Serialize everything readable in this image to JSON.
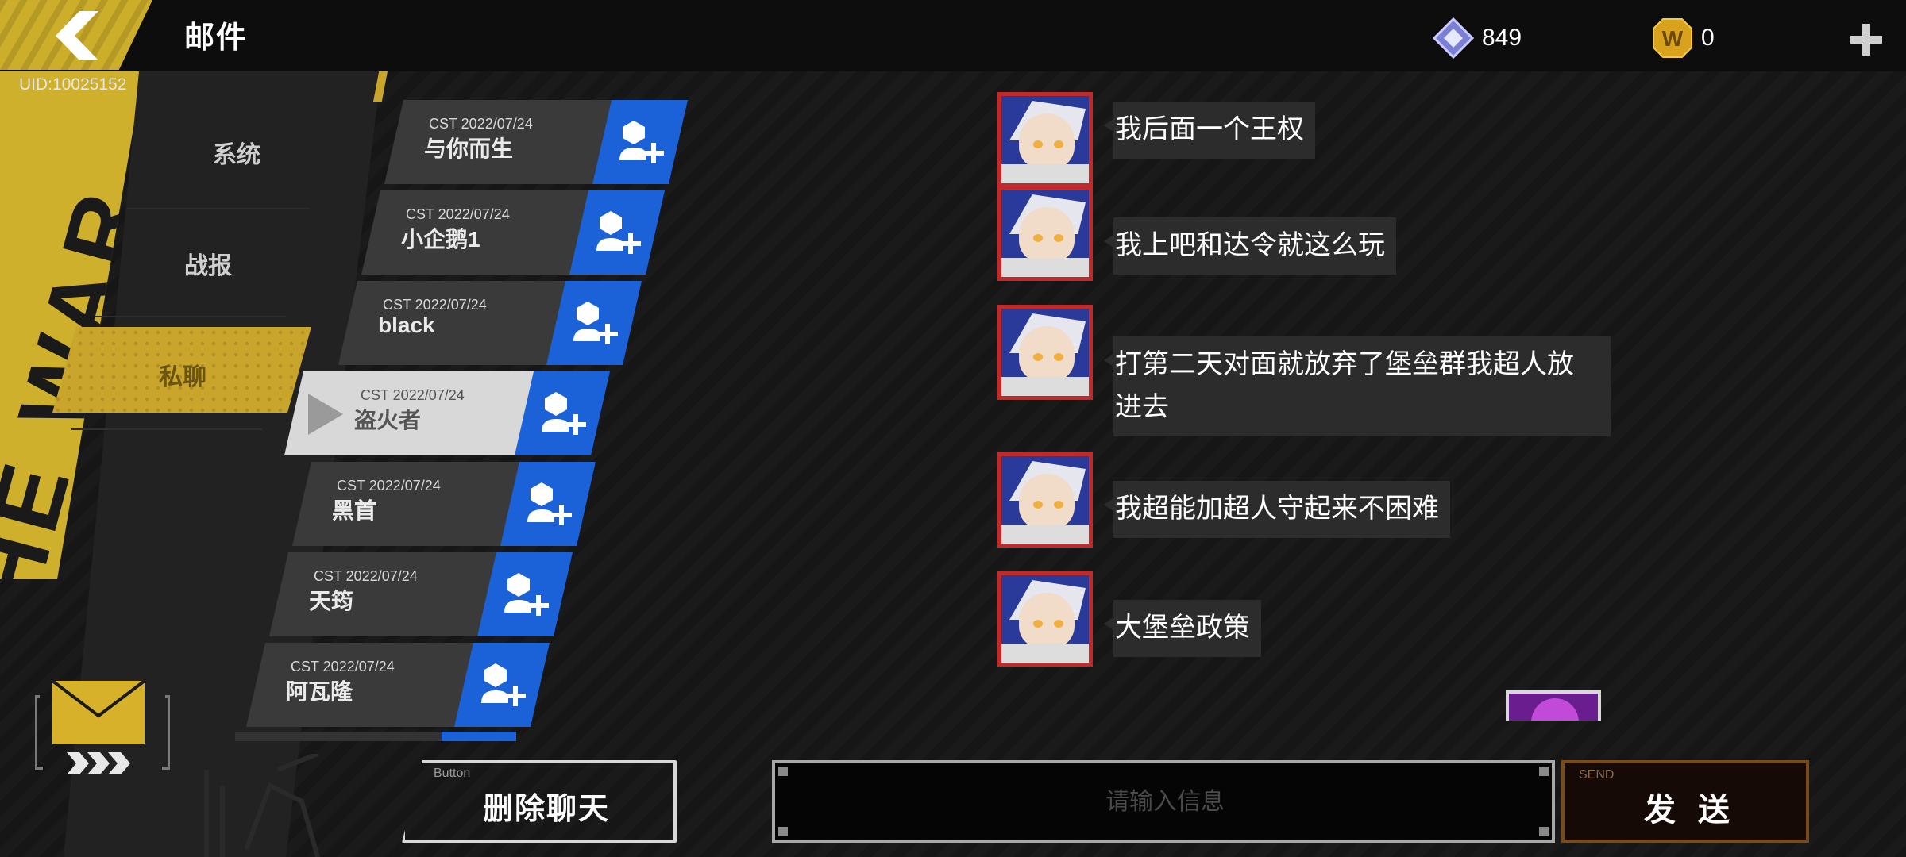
{
  "header": {
    "title": "邮件",
    "uid": "UID:10025152",
    "gems": "849",
    "coins": "0",
    "coin_symbol": "W"
  },
  "nav": {
    "items": [
      {
        "label": "系统"
      },
      {
        "label": "战报"
      },
      {
        "label": "私聊"
      }
    ],
    "active_index": 2
  },
  "contacts": [
    {
      "date": "CST 2022/07/24",
      "name": "与你而生"
    },
    {
      "date": "CST 2022/07/24",
      "name": "小企鹅1"
    },
    {
      "date": "CST 2022/07/24",
      "name": "black"
    },
    {
      "date": "CST 2022/07/24",
      "name": "盗火者"
    },
    {
      "date": "CST 2022/07/24",
      "name": "黑首"
    },
    {
      "date": "CST 2022/07/24",
      "name": "天筠"
    },
    {
      "date": "CST 2022/07/24",
      "name": "阿瓦隆"
    }
  ],
  "active_contact_index": 3,
  "messages": [
    {
      "text": "我后面一个王权"
    },
    {
      "text": "我上吧和达令就这么玩"
    },
    {
      "text": "打第二天对面就放弃了堡垒群我超人放进去"
    },
    {
      "text": "我超能加超人守起来不困难"
    },
    {
      "text": "大堡垒政策"
    }
  ],
  "footer": {
    "delete_small": "Button",
    "delete_label": "删除聊天",
    "input_placeholder": "请输入信息",
    "send_small": "SEND",
    "send_label": "发送"
  },
  "colors": {
    "accent_yellow": "#c9a52b",
    "add_blue": "#1b62d9",
    "avatar_border": "#c22a2a",
    "send_border": "#7a4a18"
  }
}
